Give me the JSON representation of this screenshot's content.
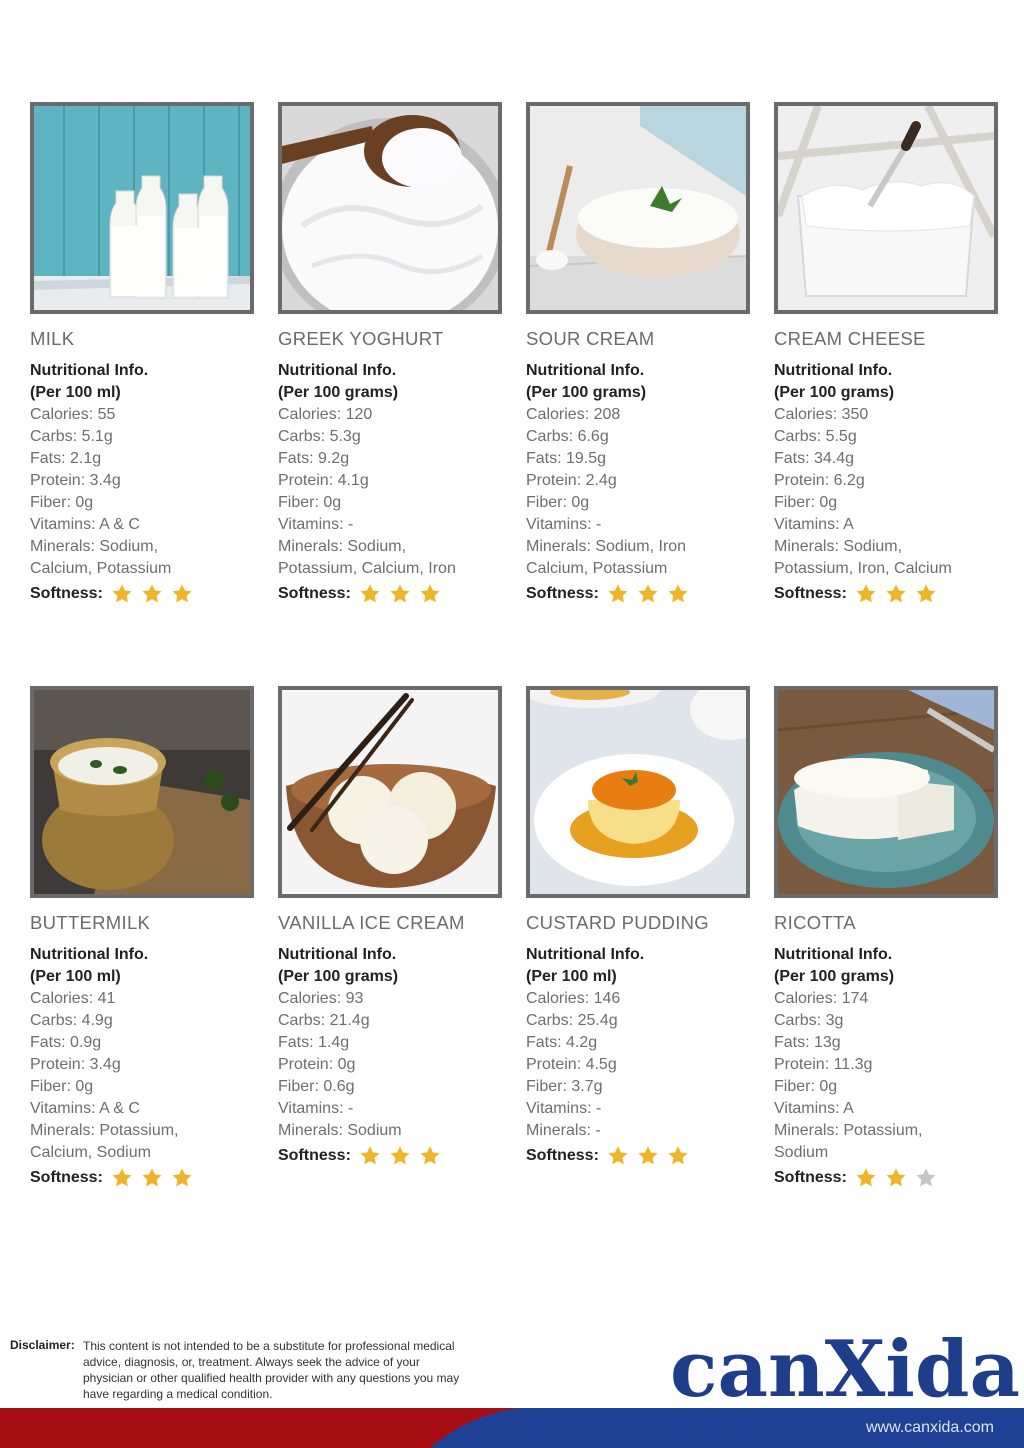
{
  "products": [
    {
      "name": "MILK",
      "header": "Nutritional Info.",
      "serving": "(Per 100 ml)",
      "lines": [
        "Calories: 55",
        "Carbs: 5.1g",
        "Fats: 2.1g",
        "Protein: 3.4g",
        "Fiber: 0g",
        "Vitamins: A & C",
        "Minerals: Sodium,",
        "Calcium, Potassium"
      ],
      "softness_label": "Softness:",
      "softness": 3
    },
    {
      "name": "GREEK YOGHURT",
      "header": "Nutritional Info.",
      "serving": "(Per 100 grams)",
      "lines": [
        "Calories: 120",
        "Carbs: 5.3g",
        "Fats: 9.2g",
        "Protein: 4.1g",
        "Fiber: 0g",
        "Vitamins: -",
        "Minerals: Sodium,",
        "Potassium, Calcium, Iron"
      ],
      "softness_label": "Softness:",
      "softness": 3
    },
    {
      "name": "SOUR CREAM",
      "header": "Nutritional Info.",
      "serving": "(Per 100 grams)",
      "lines": [
        "Calories: 208",
        "Carbs: 6.6g",
        "Fats: 19.5g",
        "Protein: 2.4g",
        "Fiber: 0g",
        "Vitamins: -",
        "Minerals: Sodium, Iron",
        "Calcium, Potassium"
      ],
      "softness_label": "Softness:",
      "softness": 3
    },
    {
      "name": "CREAM CHEESE",
      "header": "Nutritional Info.",
      "serving": "(Per 100 grams)",
      "lines": [
        "Calories: 350",
        "Carbs: 5.5g",
        "Fats: 34.4g",
        "Protein: 6.2g",
        "Fiber: 0g",
        "Vitamins: A",
        "Minerals: Sodium,",
        "Potassium, Iron, Calcium"
      ],
      "softness_label": "Softness:",
      "softness": 3
    },
    {
      "name": "BUTTERMILK",
      "header": "Nutritional Info.",
      "serving": "(Per 100 ml)",
      "lines": [
        "Calories: 41",
        "Carbs: 4.9g",
        "Fats: 0.9g",
        "Protein: 3.4g",
        "Fiber: 0g",
        "Vitamins: A & C",
        "Minerals: Potassium,",
        "Calcium, Sodium"
      ],
      "softness_label": "Softness:",
      "softness": 3
    },
    {
      "name": "VANILLA ICE CREAM",
      "header": "Nutritional Info.",
      "serving": "(Per 100 grams)",
      "lines": [
        "Calories: 93",
        "Carbs: 21.4g",
        "Fats: 1.4g",
        "Protein: 0g",
        "Fiber: 0.6g",
        "Vitamins: -",
        "Minerals: Sodium"
      ],
      "softness_label": "Softness:",
      "softness": 3
    },
    {
      "name": "CUSTARD PUDDING",
      "header": "Nutritional Info.",
      "serving": "(Per 100 ml)",
      "lines": [
        "Calories: 146",
        "Carbs: 25.4g",
        "Fats: 4.2g",
        "Protein: 4.5g",
        "Fiber: 3.7g",
        "Vitamins: -",
        "Minerals: -"
      ],
      "softness_label": "Softness:",
      "softness": 3
    },
    {
      "name": "RICOTTA",
      "header": "Nutritional Info.",
      "serving": "(Per 100 grams)",
      "lines": [
        "Calories: 174",
        "Carbs: 3g",
        "Fats: 13g",
        "Protein: 11.3g",
        "Fiber: 0g",
        "Vitamins: A",
        "Minerals: Potassium,",
        "Sodium"
      ],
      "softness_label": "Softness:",
      "softness": 2
    }
  ],
  "disclaimer": {
    "label": "Disclaimer:",
    "text": "This content is not intended to be a substitute for professional medical advice, diagnosis, or, treatment. Always seek the advice of your physician or other qualified health provider with any questions you may have regarding a medical condition."
  },
  "brand": {
    "logo_text": "canXida",
    "url": "www.canxida.com"
  },
  "colors": {
    "star_filled": "#f0b429",
    "star_empty": "#c4c4c4",
    "footer_red": "#a50d12",
    "footer_blue": "#1e4196",
    "logo_blue": "#1e3e8c",
    "frame": "#6b6b6b"
  }
}
